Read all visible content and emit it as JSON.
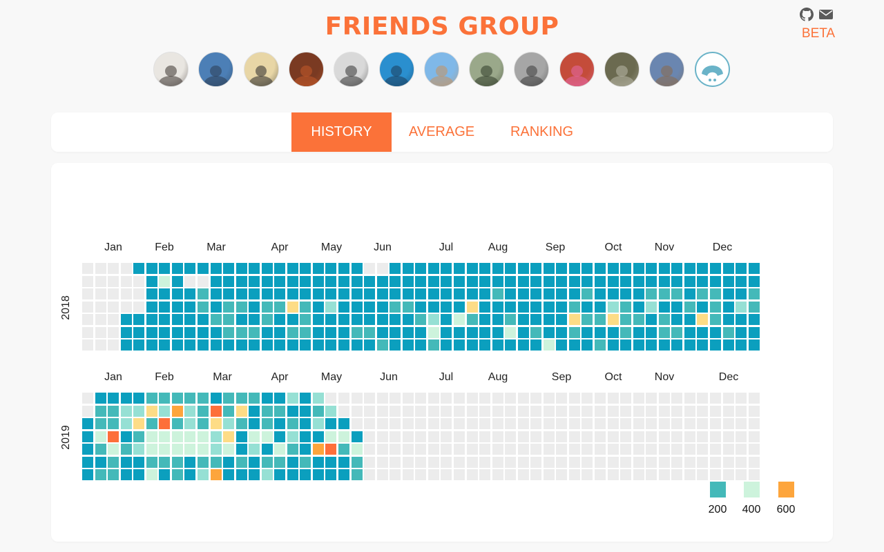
{
  "header": {
    "title": "FRIENDS GROUP",
    "beta_label": "BETA",
    "icons": [
      "github-icon",
      "mail-icon"
    ]
  },
  "avatars": [
    {
      "name": "friend-1",
      "bg": "#e9e6e1",
      "fg": "#3a3330"
    },
    {
      "name": "friend-2",
      "bg": "#4c7fb6",
      "fg": "#2b3d52"
    },
    {
      "name": "friend-3",
      "bg": "#e8d6a6",
      "fg": "#2a2a2a"
    },
    {
      "name": "friend-4",
      "bg": "#7a3a22",
      "fg": "#c25a2a"
    },
    {
      "name": "friend-5",
      "bg": "#d9d9d9",
      "fg": "#333333"
    },
    {
      "name": "friend-6",
      "bg": "#2a8fcf",
      "fg": "#1b3d5a"
    },
    {
      "name": "friend-7",
      "bg": "#7fb8e8",
      "fg": "#c7925e"
    },
    {
      "name": "friend-8",
      "bg": "#9aa88a",
      "fg": "#2f3a28"
    },
    {
      "name": "friend-9",
      "bg": "#a6a6a6",
      "fg": "#3a3a3a"
    },
    {
      "name": "friend-10",
      "bg": "#c44c3a",
      "fg": "#e56aa8"
    },
    {
      "name": "friend-11",
      "bg": "#6b6a50",
      "fg": "#b9b8a8"
    },
    {
      "name": "friend-12",
      "bg": "#6a86b0",
      "fg": "#8a6a4a"
    },
    {
      "name": "default-avatar",
      "bg": "#ffffff",
      "fg": "#6ab3c8"
    }
  ],
  "tabs": [
    {
      "label": "HISTORY",
      "active": true
    },
    {
      "label": "AVERAGE",
      "active": false
    },
    {
      "label": "RANKING",
      "active": false
    }
  ],
  "chart_data": {
    "type": "heatmap",
    "colors": {
      "empty": "#ececec",
      "darkteal": "#0b9fbe",
      "teal": "#44b9b9",
      "lightteal": "#96e0d4",
      "mint": "#cdf3dc",
      "yellow": "#fddc86",
      "orange": "#fda53c",
      "darkorange": "#fd6f3a"
    },
    "years": [
      {
        "label": "2018",
        "months": [
          "Jan",
          "Feb",
          "Mar",
          "Apr",
          "May",
          "Jun",
          "Jul",
          "Aug",
          "Sep",
          "Oct",
          "Nov",
          "Dec"
        ],
        "rows": [
          "....DDDDDDDDDDDDDDDDDD..DDDDDDDDDDDDDDDDDDDDDDDDDDDDDDDDDDDDDDDDDDDDDD",
          ".....DmD..DDDDDDDDDDDDDDDDDDDDDDDDDDDDDDDDDDDDDDDDDDDDDDDDDDDDDDDTOTDDD",
          ".....DDDDTDDDDDDDDDDDDDDDDDDDDDDTDDDDDDTDDDDTTTDTTDDTTTDTTDDDDDD",
          ".....DDDDTDTTDTTYTDLDDDDTTDDDDYDDDDDDDTDDLTDLDDTDTDLTLTDDLTDTD",
          "...DDDDDDDTTDDTDDTDDDDDDDDTLDmTDDTDDDDYTTYTTDTDDYTDDDTTTYDT",
          "...DDDDDDDDTTTDDTTDDDTTDDDDmDDDDDmDTDDTDDDTDDTTDDDTDDTYYDD",
          "...DDDDDDDDDDDDDDDDDDDDTDDDTDDDDDDDDmDDDTDDDDDDDDDDDDDDDDDD"
        ]
      },
      {
        "label": "2019",
        "months": [
          "Jan",
          "Feb",
          "Mar",
          "Apr",
          "May",
          "Jun",
          "Jul",
          "Aug",
          "Sep",
          "Oct",
          "Nov",
          "Dec"
        ],
        "rows": [
          ".DDDDTTTTTDTTTDDLDL...............................................",
          ".TTLLYLOLTRTYDTTDDTL...............................................",
          "DTTLYTRTLTYLTDTDTDLDD..............................................",
          "DmRDTmmmmmLYDmmDLDDmmD..............................................",
          "DTmTLmmmmmLmDLDmTDORTm..............................................",
          "DDTDDTTTDTTDTDTTDTDDDT..............................................",
          "DTTDDmDTDLODDDLDDDDDDT.............................................."
        ]
      }
    ],
    "legend": [
      {
        "label": "200",
        "color": "#44b9b9"
      },
      {
        "label": "400",
        "color": "#cdf3dc"
      },
      {
        "label": "600",
        "color": "#fda53c"
      }
    ]
  }
}
